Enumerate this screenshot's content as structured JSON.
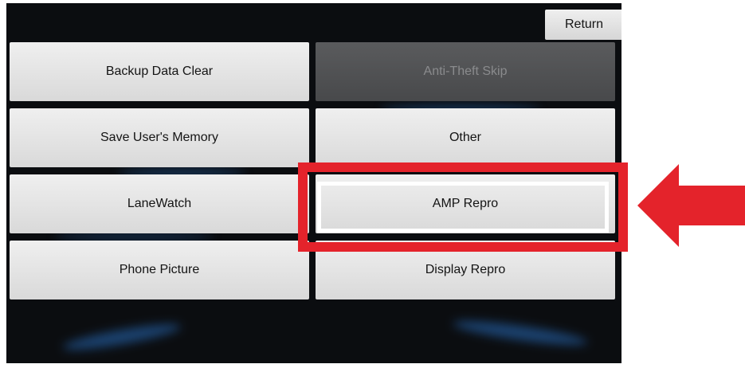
{
  "header": {
    "return_label": "Return"
  },
  "menu": {
    "left": [
      {
        "label": "Backup Data Clear"
      },
      {
        "label": "Save User's Memory"
      },
      {
        "label": "LaneWatch"
      },
      {
        "label": "Phone Picture"
      }
    ],
    "right": [
      {
        "label": "Anti-Theft Skip",
        "disabled": true
      },
      {
        "label": "Other"
      },
      {
        "label": "AMP Repro",
        "highlighted": true
      },
      {
        "label": "Display Repro"
      }
    ]
  },
  "annotation": {
    "highlight_color": "#e4232b",
    "arrow_color": "#e4232b",
    "arrow_icon": "arrow-left-icon"
  }
}
